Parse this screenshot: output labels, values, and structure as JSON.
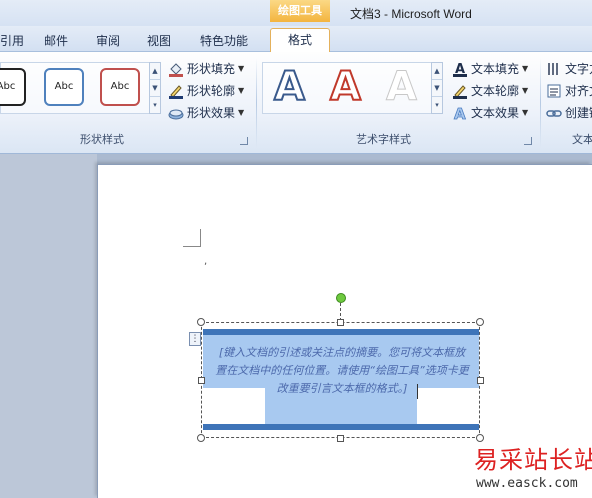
{
  "titlebar": {
    "context_group": "绘图工具",
    "title": "文档3 - Microsoft Word"
  },
  "tabs": {
    "references_partial": "引用",
    "mailings": "邮件",
    "review": "审阅",
    "view": "视图",
    "special": "特色功能",
    "format": "格式"
  },
  "ribbon": {
    "shape_styles": {
      "label": "形状样式",
      "gallery": [
        {
          "text": "Abc",
          "border": "#222222"
        },
        {
          "text": "Abc",
          "border": "#4f81bd"
        },
        {
          "text": "Abc",
          "border": "#c0504d"
        }
      ],
      "fill": "形状填充",
      "outline": "形状轮廓",
      "effects": "形状效果"
    },
    "wordart_styles": {
      "label": "艺术字样式",
      "gallery": [
        {
          "text": "A",
          "style": "blue-outline"
        },
        {
          "text": "A",
          "style": "red-outline"
        },
        {
          "text": "A",
          "style": "white-outline"
        }
      ],
      "text_fill": "文本填充",
      "text_outline": "文本轮廓",
      "text_effects": "文本效果"
    },
    "text_group": {
      "label_partial": "文本",
      "direction_partial": "文字方",
      "align_partial": "对齐文",
      "link_partial": "创建链"
    }
  },
  "document": {
    "textbox": {
      "line1": "[键入文档的引述或关注点的摘要。您可将文本框放",
      "line2": "置在文档中的任何位置。请使用“绘图工具”选项卡更",
      "line3": "改重要引言文本框的格式。]",
      "accent_color": "#3e74b8",
      "highlight_color": "#a8c9f0"
    }
  },
  "watermark": {
    "site_name": "易采站长站",
    "url": "www.easck.com"
  }
}
